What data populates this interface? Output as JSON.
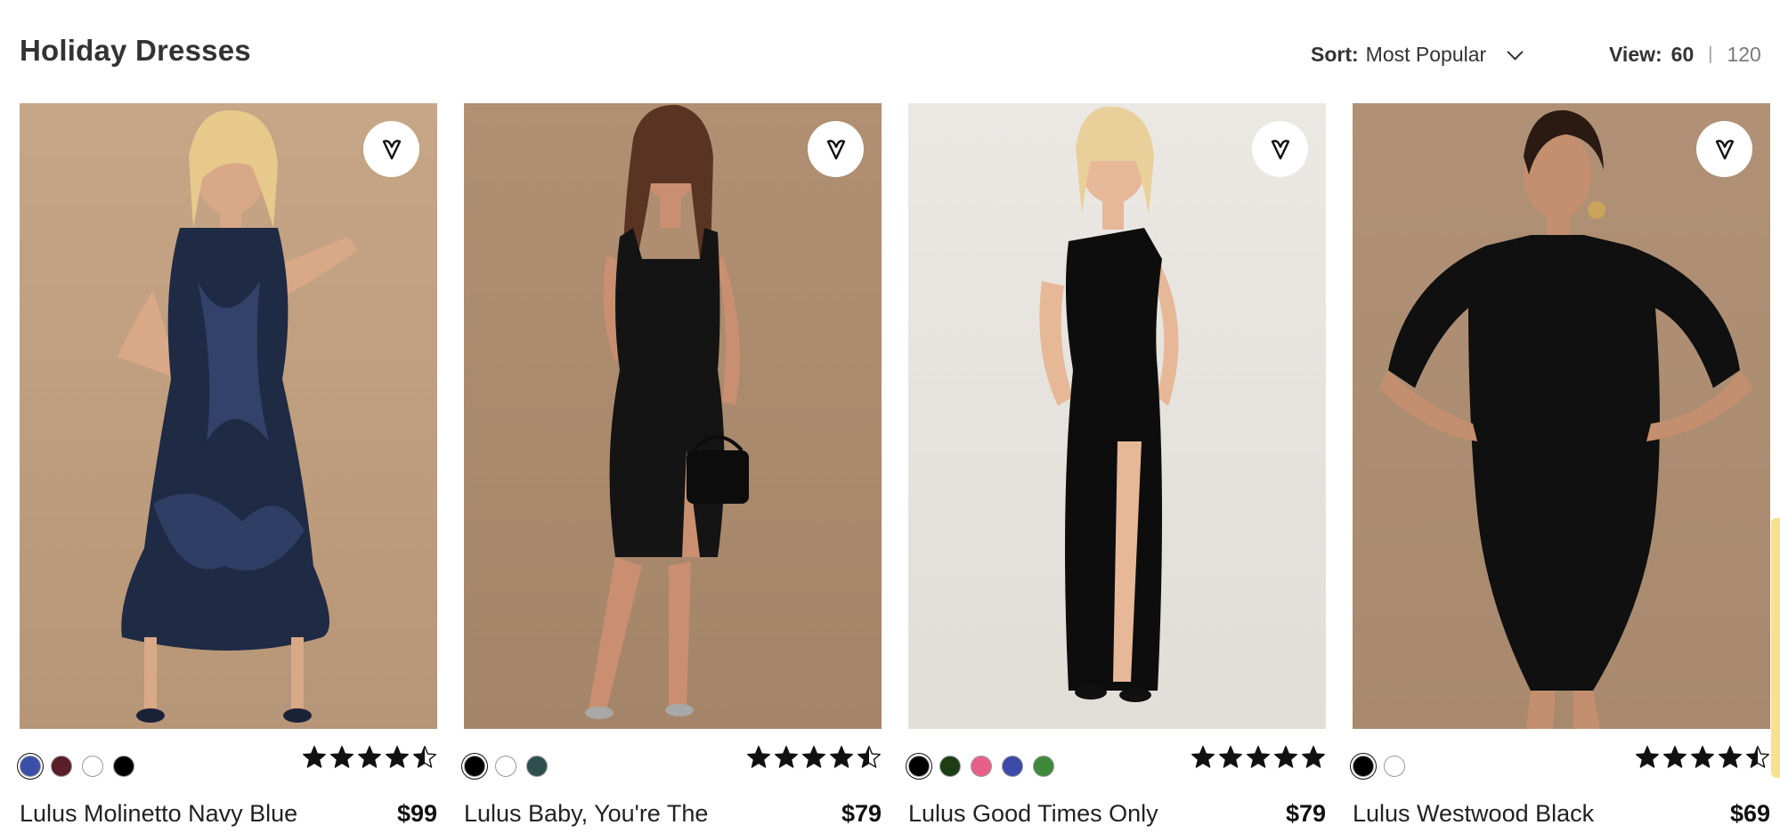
{
  "header": {
    "title": "Holiday Dresses",
    "sort_label": "Sort:",
    "sort_value": "Most Popular",
    "view_label": "View:",
    "view_options": [
      "60",
      "120"
    ],
    "view_separator": "|",
    "view_selected": "60"
  },
  "products": [
    {
      "name": "Lulus Molinetto Navy Blue",
      "price": "$99",
      "rating": 4.5,
      "swatches": [
        "#3a4fa8",
        "#5a1f2a",
        "#ffffff",
        "#000000"
      ],
      "selected_swatch": 0
    },
    {
      "name": "Lulus Baby, You're The",
      "price": "$79",
      "rating": 4.5,
      "swatches": [
        "#000000",
        "#ffffff",
        "#2f4f4f"
      ],
      "selected_swatch": 0
    },
    {
      "name": "Lulus Good Times Only",
      "price": "$79",
      "rating": 5,
      "swatches": [
        "#000000",
        "#1d3d14",
        "#e8608a",
        "#3c4aa8",
        "#3f8a3a"
      ],
      "selected_swatch": 0
    },
    {
      "name": "Lulus Westwood Black",
      "price": "$69",
      "rating": 4.5,
      "swatches": [
        "#000000",
        "#ffffff"
      ],
      "selected_swatch": 0
    }
  ],
  "icons": {
    "favorite": "heart-icon",
    "sort": "chevron-down-icon",
    "rating": "star-icon"
  },
  "colors": {
    "text_primary": "#333333",
    "star": "#111111",
    "photo_tan": "#b89a7e",
    "photo_light": "#e8e4df"
  }
}
